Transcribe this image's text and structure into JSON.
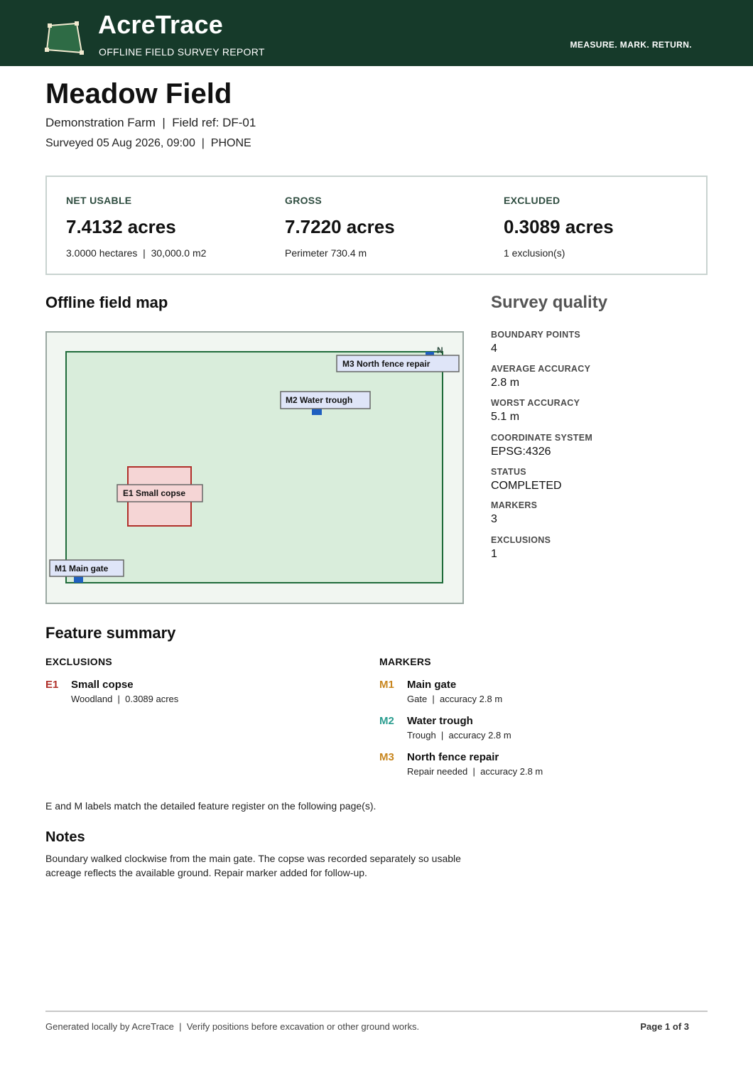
{
  "header": {
    "brand": "AcreTrace",
    "subtitle": "OFFLINE FIELD SURVEY REPORT",
    "tagline": "MEASURE. MARK. RETURN.",
    "logo_icon": "field-polygon-icon"
  },
  "field": {
    "name": "Meadow Field",
    "farm_line": "Demonstration Farm  |  Field ref: DF-01",
    "survey_line": "Surveyed 05 Aug 2026, 09:00  |  PHONE"
  },
  "stats": [
    {
      "label": "NET USABLE",
      "value": "7.4132 acres",
      "sub": "3.0000 hectares  |  30,000.0 m2"
    },
    {
      "label": "GROSS",
      "value": "7.7220 acres",
      "sub": "Perimeter 730.4 m"
    },
    {
      "label": "EXCLUDED",
      "value": "0.3089 acres",
      "sub": "1 exclusion(s)"
    }
  ],
  "map": {
    "title": "Offline field map",
    "north": "N",
    "exclusion_label": "E1 Small copse",
    "marker_labels": [
      "M1 Main gate",
      "M2 Water trough",
      "M3 North fence repair"
    ],
    "colors": {
      "field_fill": "#d9eddb",
      "field_stroke": "#1f6b3a",
      "exclusion_fill": "#f5d5d5",
      "exclusion_stroke": "#b0302a",
      "marker": "#1f5fc0",
      "label_fill": "#dfe5f8"
    }
  },
  "quality": {
    "title": "Survey quality",
    "items": [
      {
        "label": "BOUNDARY POINTS",
        "value": "4"
      },
      {
        "label": "AVERAGE ACCURACY",
        "value": "2.8 m"
      },
      {
        "label": "WORST ACCURACY",
        "value": "5.1 m"
      },
      {
        "label": "COORDINATE SYSTEM",
        "value": "EPSG:4326"
      },
      {
        "label": "STATUS",
        "value": "COMPLETED"
      },
      {
        "label": "MARKERS",
        "value": "3"
      },
      {
        "label": "EXCLUSIONS",
        "value": "1"
      }
    ]
  },
  "features": {
    "title": "Feature summary",
    "exclusions_heading": "EXCLUSIONS",
    "markers_heading": "MARKERS",
    "exclusions": [
      {
        "code": "E1",
        "name": "Small copse",
        "detail": "Woodland  |  0.3089 acres",
        "color": "#b0302a"
      }
    ],
    "markers": [
      {
        "code": "M1",
        "name": "Main gate",
        "detail": "Gate  |  accuracy 2.8 m",
        "color": "#c8861e"
      },
      {
        "code": "M2",
        "name": "Water trough",
        "detail": "Trough  |  accuracy 2.8 m",
        "color": "#2a9d8f"
      },
      {
        "code": "M3",
        "name": "North fence repair",
        "detail": "Repair needed  |  accuracy 2.8 m",
        "color": "#c8861e"
      }
    ],
    "register_note": "E and M labels match the detailed feature register on the following page(s)."
  },
  "notes": {
    "title": "Notes",
    "body": "Boundary walked clockwise from the main gate. The copse was recorded separately so usable acreage reflects the available ground. Repair marker added for follow-up."
  },
  "footer": {
    "left": "Generated locally by AcreTrace  |  Verify positions before excavation or other ground works.",
    "page": "Page 1 of 3"
  }
}
